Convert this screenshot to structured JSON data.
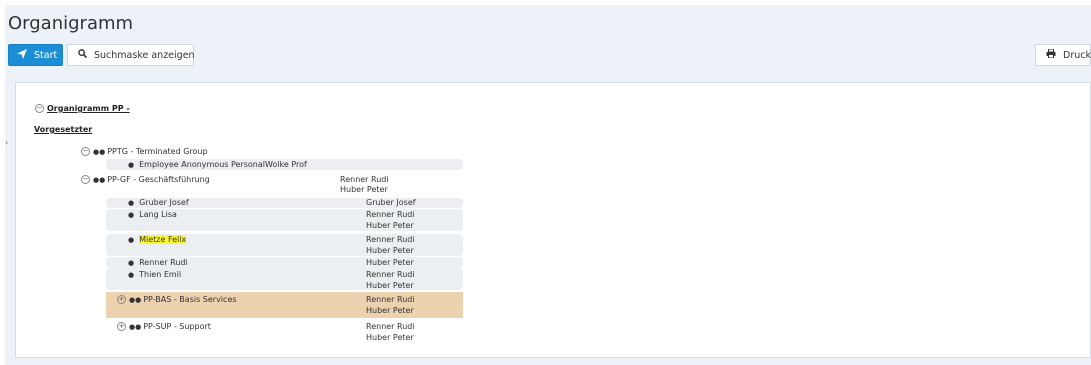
{
  "page": {
    "title": "Organigramm"
  },
  "toolbar": {
    "start_label": "Start",
    "search_label": "Suchmaske anzeigen",
    "print_label": "Druck"
  },
  "tree": {
    "root_label": "Organigramm PP -",
    "supervisor_header": "Vorgesetzter",
    "pptg": {
      "label": "PPTG - Terminated Group",
      "member": "Employee Anonymous PersonalWolke Prof"
    },
    "ppgf": {
      "label": "PP-GF - Geschäftsführung",
      "supervisors": [
        "Renner Rudi",
        "Huber Peter"
      ],
      "members": [
        {
          "name": "Gruber Josef",
          "supervisors": [
            "Gruber Josef"
          ]
        },
        {
          "name": "Lang Lisa",
          "supervisors": [
            "Renner Rudi",
            "Huber Peter"
          ]
        },
        {
          "name": "Mietze Felix",
          "supervisors": [
            "Renner Rudi",
            "Huber Peter"
          ]
        },
        {
          "name": "Renner Rudi",
          "supervisors": [
            "Huber Peter"
          ]
        },
        {
          "name": "Thien Emil",
          "supervisors": [
            "Renner Rudi",
            "Huber Peter"
          ]
        }
      ],
      "subgroups": [
        {
          "label": "PP-BAS - Basis Services",
          "supervisors": [
            "Renner Rudi",
            "Huber Peter"
          ]
        },
        {
          "label": "PP-SUP - Support",
          "supervisors": [
            "Renner Rudi",
            "Huber Peter"
          ]
        }
      ]
    }
  },
  "icons": {
    "start": "paper-plane-icon",
    "search": "search-icon",
    "print": "print-icon",
    "person": "user-icon",
    "group": "users-icon"
  },
  "colors": {
    "primary": "#1c8ed6",
    "highlight_row": "#ecd2ae",
    "text_mark": "#fdf72e"
  }
}
